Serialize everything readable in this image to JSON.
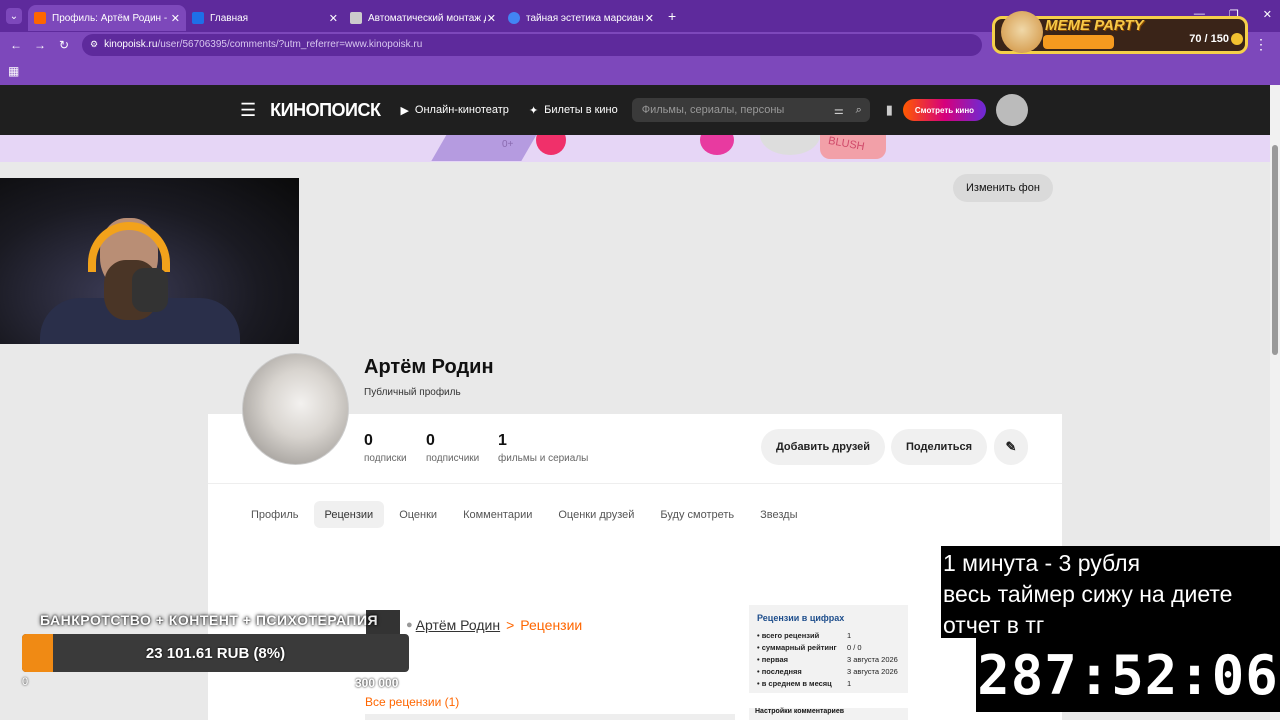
{
  "browser": {
    "tabs": [
      {
        "title": "Профиль: Артём Родин - Рецензии",
        "active": true,
        "favicon_color": "#ff6600"
      },
      {
        "title": "Главная",
        "active": false,
        "favicon_color": "#1e6fe8"
      },
      {
        "title": "Автоматический монтаж для видео",
        "active": false,
        "favicon_color": "#cccccc"
      },
      {
        "title": "тайная эстетика марсианских",
        "active": false,
        "favicon_color": "#4285f4"
      }
    ],
    "url_host": "kinopoisk.ru",
    "url_rest": "/user/56706395/comments/?utm_referrer=www.kinopoisk.ru"
  },
  "kp_header": {
    "logo": "КИНОПОИСК",
    "online_cinema": "Онлайн-кинотеатр",
    "tickets": "Билеты в кино",
    "search_placeholder": "Фильмы, сериалы, персоны",
    "watch_button": "Смотреть кино"
  },
  "banner": {
    "age": "0+",
    "brand_text": "BLUSH"
  },
  "change_bg": "Изменить фон",
  "profile": {
    "name": "Артём Родин",
    "type": "Публичный профиль",
    "stats": [
      {
        "value": "0",
        "label": "подписки"
      },
      {
        "value": "0",
        "label": "подписчики"
      },
      {
        "value": "1",
        "label": "фильмы и сериалы"
      }
    ],
    "add_friends": "Добавить друзей",
    "share": "Поделиться"
  },
  "profile_tabs": [
    "Профиль",
    "Рецензии",
    "Оценки",
    "Комментарии",
    "Оценки друзей",
    "Буду смотреть",
    "Звезды"
  ],
  "reviews": {
    "crumb_user": "Артём Родин",
    "crumb_sep": ">",
    "crumb_section": "Рецензии",
    "all_reviews": "Все рецензии (1)"
  },
  "review_stats": {
    "title": "Рецензии в цифрах",
    "rows": [
      {
        "k": "• всего рецензий",
        "v": "1"
      },
      {
        "k": "• суммарный рейтинг",
        "v": "0 / 0"
      },
      {
        "k": "• первая",
        "v": "3 августа 2026"
      },
      {
        "k": "• последняя",
        "v": "3 августа 2026"
      },
      {
        "k": "• в среднем в месяц",
        "v": "1"
      }
    ],
    "next_box_title": "Настройки комментариев"
  },
  "overlay": {
    "meme_title": "MEME PARTY",
    "meme_count": "70 / 150",
    "meme_progress": 0.47,
    "donation_title": "БАНКРОТСТВО + КОНТЕНТ + ПСИХОТЕРАПИЯ",
    "donation_text": "23 101.61 RUB (8%)",
    "donation_progress": 0.08,
    "donation_min": "0",
    "donation_max": "300 000",
    "timer_lines": [
      "1 минута - 3 рубля",
      "весь таймер сижу на диете",
      "отчет в тг"
    ],
    "timer_clock": "287:52:06"
  }
}
